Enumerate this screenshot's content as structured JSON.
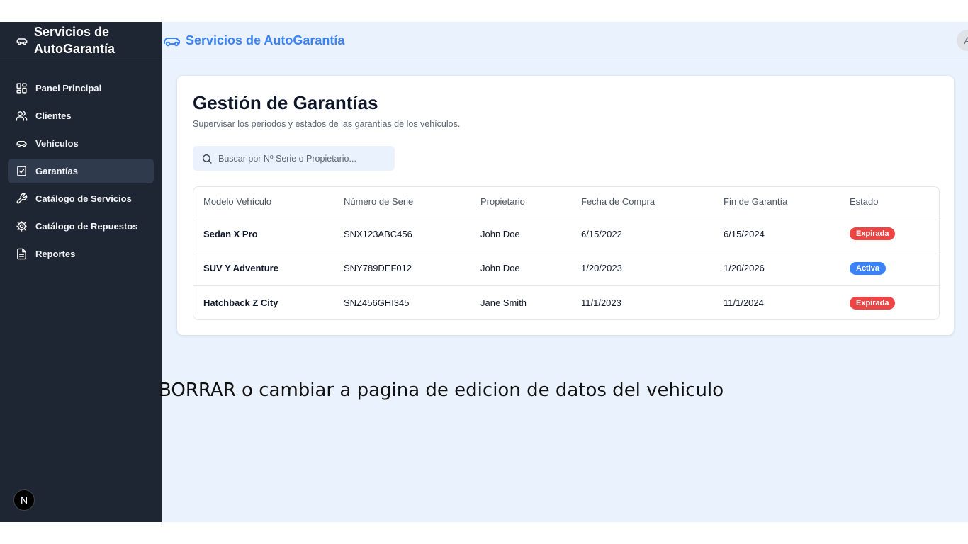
{
  "sidebar": {
    "title": "Servicios de AutoGarantía",
    "items": [
      {
        "label": "Panel Principal",
        "icon": "dashboard-icon"
      },
      {
        "label": "Clientes",
        "icon": "users-icon"
      },
      {
        "label": "Vehículos",
        "icon": "car-icon"
      },
      {
        "label": "Garantías",
        "icon": "checklist-icon",
        "active": true
      },
      {
        "label": "Catálogo de Servicios",
        "icon": "wrench-icon"
      },
      {
        "label": "Catálogo de Repuestos",
        "icon": "gear-icon"
      },
      {
        "label": "Reportes",
        "icon": "document-icon"
      }
    ],
    "badge": "N"
  },
  "topbar": {
    "title": "Servicios de AutoGarantía",
    "avatar": "A"
  },
  "page": {
    "title": "Gestión de Garantías",
    "subtitle": "Supervisar los períodos y estados de las garantías de los vehículos.",
    "search_placeholder": "Buscar por Nº Serie o Propietario..."
  },
  "table": {
    "headers": [
      "Modelo Vehículo",
      "Número de Serie",
      "Propietario",
      "Fecha de Compra",
      "Fin de Garantía",
      "Estado"
    ],
    "rows": [
      {
        "model": "Sedan X Pro",
        "serial": "SNX123ABC456",
        "owner": "John Doe",
        "purchase": "6/15/2022",
        "end": "6/15/2024",
        "status": "Expirada"
      },
      {
        "model": "SUV Y Adventure",
        "serial": "SNY789DEF012",
        "owner": "John Doe",
        "purchase": "1/20/2023",
        "end": "1/20/2026",
        "status": "Activa"
      },
      {
        "model": "Hatchback Z City",
        "serial": "SNZ456GHI345",
        "owner": "Jane Smith",
        "purchase": "11/1/2023",
        "end": "11/1/2024",
        "status": "Expirada"
      }
    ]
  },
  "colors": {
    "expired": "#ef4444",
    "active": "#3b82f6",
    "sidebar_bg": "#1e2533",
    "accent": "#3b82f6"
  },
  "note": "BORRAR o cambiar a pagina de edicion de datos del vehiculo"
}
